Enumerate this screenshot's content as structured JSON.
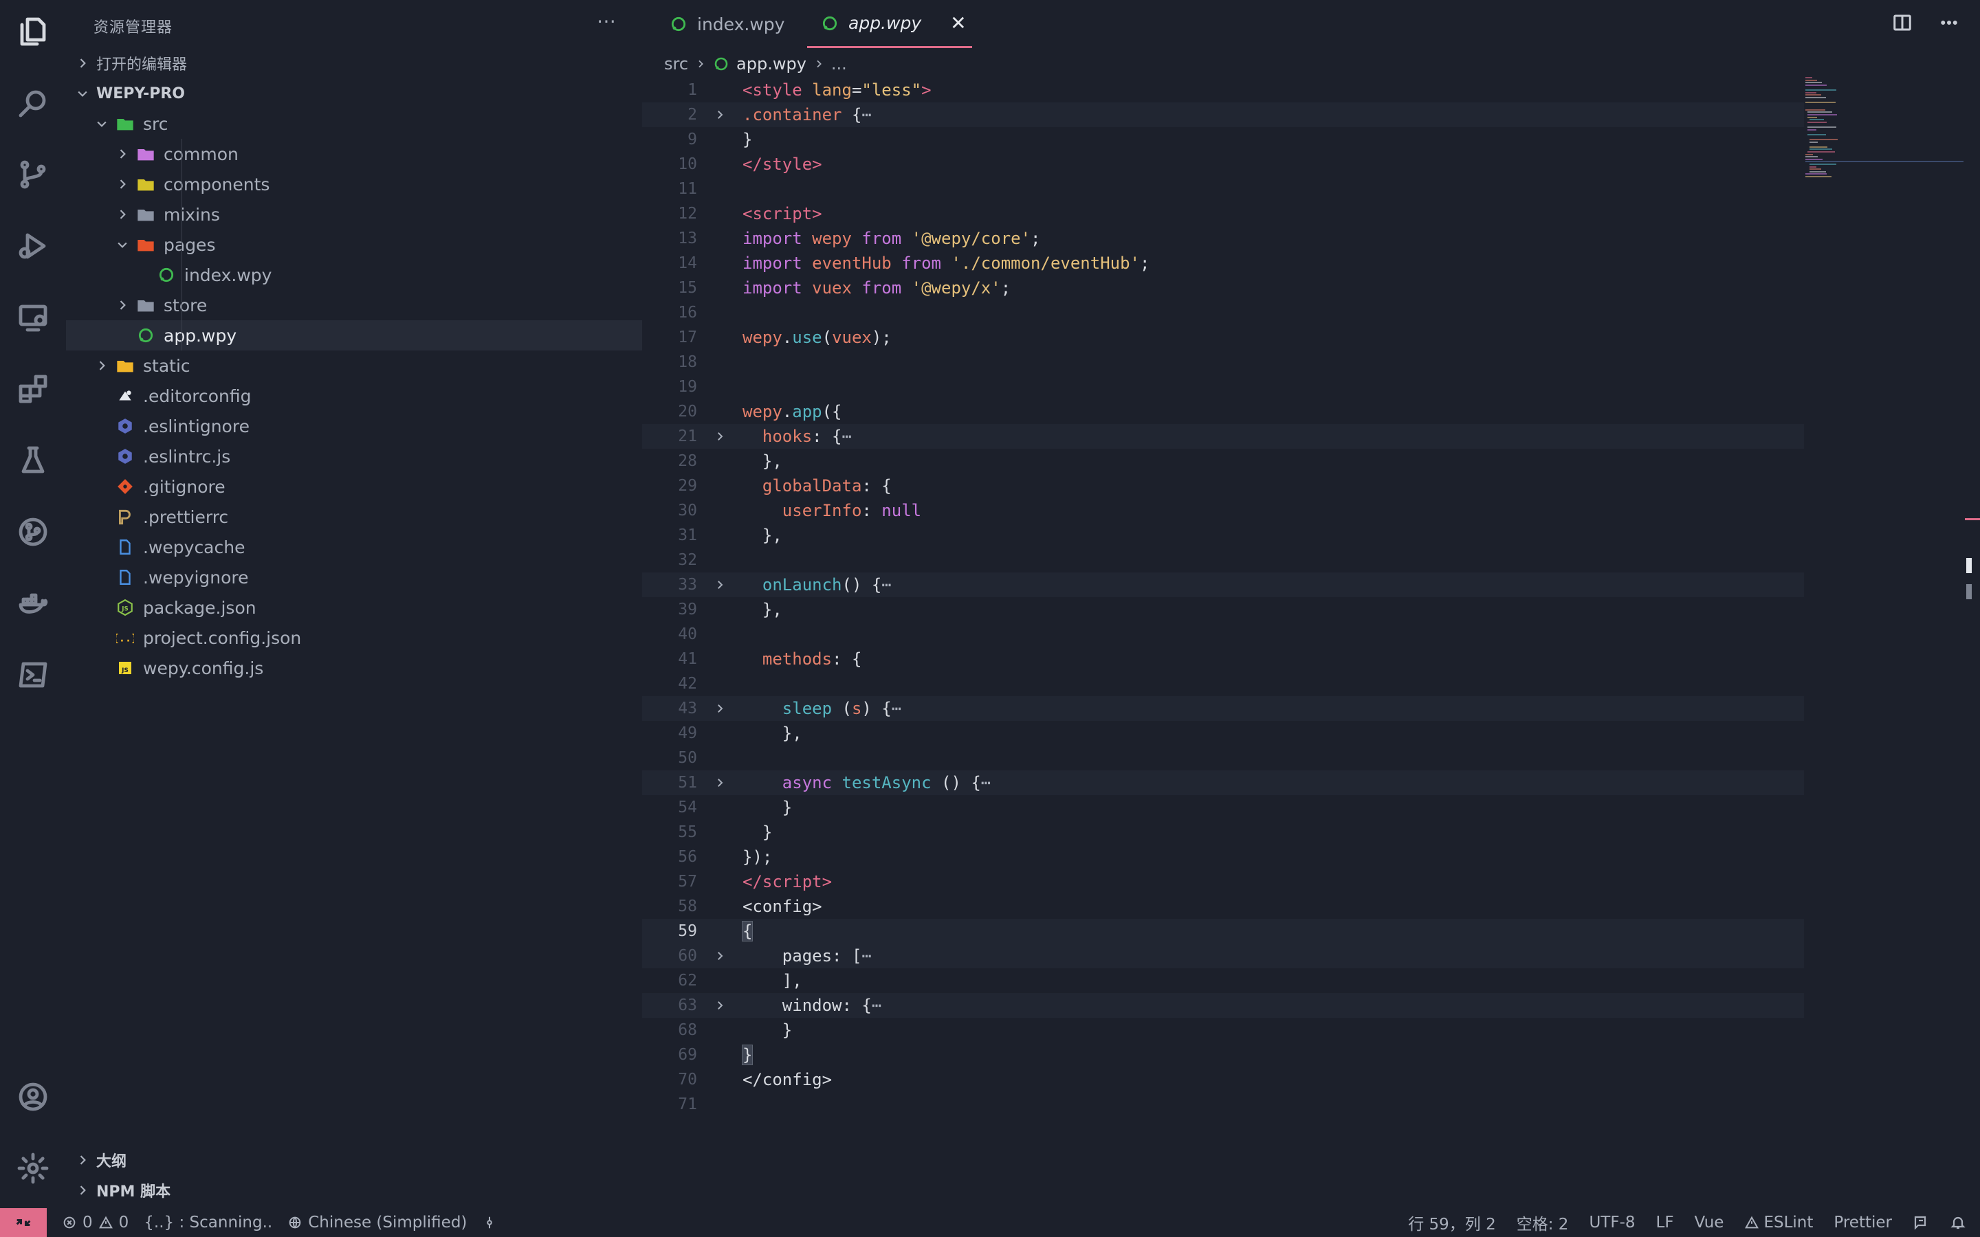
{
  "explorer": {
    "title": "资源管理器",
    "more": "⋯",
    "open_editors": "打开的编辑器",
    "project": "WEPY-PRO",
    "tree": [
      {
        "label": "src",
        "kind": "folder-src",
        "indent": 1,
        "open": true,
        "icon": "src-folder-icon",
        "color": "#3fb950"
      },
      {
        "label": "common",
        "kind": "folder",
        "indent": 2,
        "open": false,
        "icon": "folder-common-icon",
        "color": "#c678dd"
      },
      {
        "label": "components",
        "kind": "folder",
        "indent": 2,
        "open": false,
        "icon": "folder-components-icon",
        "color": "#d4c22a"
      },
      {
        "label": "mixins",
        "kind": "folder",
        "indent": 2,
        "open": false,
        "icon": "folder-icon",
        "color": "#8b93a3"
      },
      {
        "label": "pages",
        "kind": "folder",
        "indent": 2,
        "open": true,
        "icon": "folder-pages-icon",
        "color": "#e5532b"
      },
      {
        "label": "index.wpy",
        "kind": "file",
        "indent": 3,
        "icon": "wpy-file-icon",
        "color": "#3fb950"
      },
      {
        "label": "store",
        "kind": "folder",
        "indent": 2,
        "open": false,
        "icon": "folder-icon",
        "color": "#8b93a3"
      },
      {
        "label": "app.wpy",
        "kind": "file",
        "indent": 2,
        "icon": "wpy-file-icon",
        "color": "#3fb950",
        "selected": true
      },
      {
        "label": "static",
        "kind": "folder",
        "indent": 1,
        "open": false,
        "icon": "folder-static-icon",
        "color": "#f0b429"
      },
      {
        "label": ".editorconfig",
        "kind": "file",
        "indent": 1,
        "icon": "editorconfig-icon",
        "color": "#e6e9ee"
      },
      {
        "label": ".eslintignore",
        "kind": "file",
        "indent": 1,
        "icon": "eslint-icon",
        "color": "#5c6bc0"
      },
      {
        "label": ".eslintrc.js",
        "kind": "file",
        "indent": 1,
        "icon": "eslint-icon",
        "color": "#5c6bc0"
      },
      {
        "label": ".gitignore",
        "kind": "file",
        "indent": 1,
        "icon": "git-icon",
        "color": "#e5532b"
      },
      {
        "label": ".prettierrc",
        "kind": "file",
        "indent": 1,
        "icon": "prettier-icon",
        "color": "#c0a060"
      },
      {
        "label": ".wepycache",
        "kind": "file",
        "indent": 1,
        "icon": "file-icon",
        "color": "#4a90e2"
      },
      {
        "label": ".wepyignore",
        "kind": "file",
        "indent": 1,
        "icon": "file-icon",
        "color": "#4a90e2"
      },
      {
        "label": "package.json",
        "kind": "file",
        "indent": 1,
        "icon": "nodejs-icon",
        "color": "#8bc34a"
      },
      {
        "label": "project.config.json",
        "kind": "file",
        "indent": 1,
        "icon": "json-icon",
        "color": "#f0b429"
      },
      {
        "label": "wepy.config.js",
        "kind": "file",
        "indent": 1,
        "icon": "js-icon",
        "color": "#f0d52a"
      }
    ],
    "outline": "大纲",
    "npm": "NPM 脚本"
  },
  "tabs": [
    {
      "label": "index.wpy",
      "active": false
    },
    {
      "label": "app.wpy",
      "active": true,
      "close": "✕"
    }
  ],
  "breadcrumb": {
    "folder": "src",
    "file": "app.wpy",
    "more": "..."
  },
  "code_lines": [
    {
      "n": "1",
      "fold": false,
      "html": "<span class='tg'>&lt;style </span><span class='at'>lang</span><span class='pl'>=</span><span class='st'>\"less\"</span><span class='tg'>&gt;</span>"
    },
    {
      "n": "2",
      "fold": true,
      "html": "<span class='vr'>.container</span><span class='pl'> {</span><span class='ell'>⋯</span>"
    },
    {
      "n": "9",
      "fold": false,
      "html": "<span class='pl'>}</span>"
    },
    {
      "n": "10",
      "fold": false,
      "html": "<span class='tg'>&lt;/style&gt;</span>"
    },
    {
      "n": "11",
      "fold": false,
      "html": ""
    },
    {
      "n": "12",
      "fold": false,
      "html": "<span class='tg'>&lt;script&gt;</span>"
    },
    {
      "n": "13",
      "fold": false,
      "html": "<span class='kw'>import</span><span class='pl'> </span><span class='vr'>wepy</span><span class='pl'> </span><span class='kw'>from</span><span class='pl'> </span><span class='st'>'@wepy/core'</span><span class='pl'>;</span>"
    },
    {
      "n": "14",
      "fold": false,
      "html": "<span class='kw'>import</span><span class='pl'> </span><span class='vr'>eventHub</span><span class='pl'> </span><span class='kw'>from</span><span class='pl'> </span><span class='st'>'./common/eventHub'</span><span class='pl'>;</span>"
    },
    {
      "n": "15",
      "fold": false,
      "html": "<span class='kw'>import</span><span class='pl'> </span><span class='vr'>vuex</span><span class='pl'> </span><span class='kw'>from</span><span class='pl'> </span><span class='st'>'@wepy/x'</span><span class='pl'>;</span>"
    },
    {
      "n": "16",
      "fold": false,
      "html": ""
    },
    {
      "n": "17",
      "fold": false,
      "html": "<span class='vr'>wepy</span><span class='pl'>.</span><span class='fn'>use</span><span class='pl'>(</span><span class='vr'>vuex</span><span class='pl'>);</span>"
    },
    {
      "n": "18",
      "fold": false,
      "html": ""
    },
    {
      "n": "19",
      "fold": false,
      "html": ""
    },
    {
      "n": "20",
      "fold": false,
      "html": "<span class='vr'>wepy</span><span class='pl'>.</span><span class='fn'>app</span><span class='pl'>({</span>"
    },
    {
      "n": "21",
      "fold": true,
      "html": "<span class='pl'>  </span><span class='pr'>hooks</span><span class='pl'>: {</span><span class='ell'>⋯</span>"
    },
    {
      "n": "28",
      "fold": false,
      "html": "<span class='pl'>  },</span>"
    },
    {
      "n": "29",
      "fold": false,
      "html": "<span class='pl'>  </span><span class='pr'>globalData</span><span class='pl'>: {</span>"
    },
    {
      "n": "30",
      "fold": false,
      "html": "<span class='pl'>    </span><span class='pr'>userInfo</span><span class='pl'>: </span><span class='co'>null</span>"
    },
    {
      "n": "31",
      "fold": false,
      "html": "<span class='pl'>  },</span>"
    },
    {
      "n": "32",
      "fold": false,
      "html": ""
    },
    {
      "n": "33",
      "fold": true,
      "html": "<span class='pl'>  </span><span class='fn'>onLaunch</span><span class='pl'>() {</span><span class='ell'>⋯</span>"
    },
    {
      "n": "39",
      "fold": false,
      "html": "<span class='pl'>  },</span>"
    },
    {
      "n": "40",
      "fold": false,
      "html": ""
    },
    {
      "n": "41",
      "fold": false,
      "html": "<span class='pl'>  </span><span class='pr'>methods</span><span class='pl'>: {</span>"
    },
    {
      "n": "42",
      "fold": false,
      "html": ""
    },
    {
      "n": "43",
      "fold": true,
      "html": "<span class='pl'>    </span><span class='fn'>sleep</span><span class='pl'> (</span><span class='vr'>s</span><span class='pl'>) {</span><span class='ell'>⋯</span>"
    },
    {
      "n": "49",
      "fold": false,
      "html": "<span class='pl'>    },</span>"
    },
    {
      "n": "50",
      "fold": false,
      "html": ""
    },
    {
      "n": "51",
      "fold": true,
      "html": "<span class='pl'>    </span><span class='kw'>async</span><span class='pl'> </span><span class='fn'>testAsync</span><span class='pl'> () {</span><span class='ell'>⋯</span>"
    },
    {
      "n": "54",
      "fold": false,
      "html": "<span class='pl'>    }</span>"
    },
    {
      "n": "55",
      "fold": false,
      "html": "<span class='pl'>  }</span>"
    },
    {
      "n": "56",
      "fold": false,
      "html": "<span class='pl'>});</span>"
    },
    {
      "n": "57",
      "fold": false,
      "html": "<span class='tg'>&lt;/script&gt;</span>"
    },
    {
      "n": "58",
      "fold": false,
      "html": "<span class='pl'>&lt;config&gt;</span>"
    },
    {
      "n": "59",
      "fold": false,
      "cur": true,
      "html": "<span class='pl br'>{</span>"
    },
    {
      "n": "60",
      "fold": true,
      "html": "<span class='pl'>    pages: [</span><span class='ell'>⋯</span>"
    },
    {
      "n": "62",
      "fold": false,
      "html": "<span class='pl'>    ],</span>"
    },
    {
      "n": "63",
      "fold": true,
      "html": "<span class='pl'>    window: {</span><span class='ell'>⋯</span>"
    },
    {
      "n": "68",
      "fold": false,
      "html": "<span class='pl'>    }</span>"
    },
    {
      "n": "69",
      "fold": false,
      "html": "<span class='pl br'>}</span>"
    },
    {
      "n": "70",
      "fold": false,
      "html": "<span class='pl'>&lt;/config&gt;</span>"
    },
    {
      "n": "71",
      "fold": false,
      "html": ""
    }
  ],
  "status": {
    "errors": "0",
    "warnings": "0",
    "scanning": "{..} : Scanning..",
    "language_pack": "Chinese (Simplified)",
    "position": "行 59，列 2",
    "spaces": "空格: 2",
    "encoding": "UTF-8",
    "eol": "LF",
    "mode": "Vue",
    "eslint": "ESLint",
    "prettier": "Prettier"
  },
  "colors": {
    "accent": "#e06c8a",
    "background": "#1c202b"
  }
}
